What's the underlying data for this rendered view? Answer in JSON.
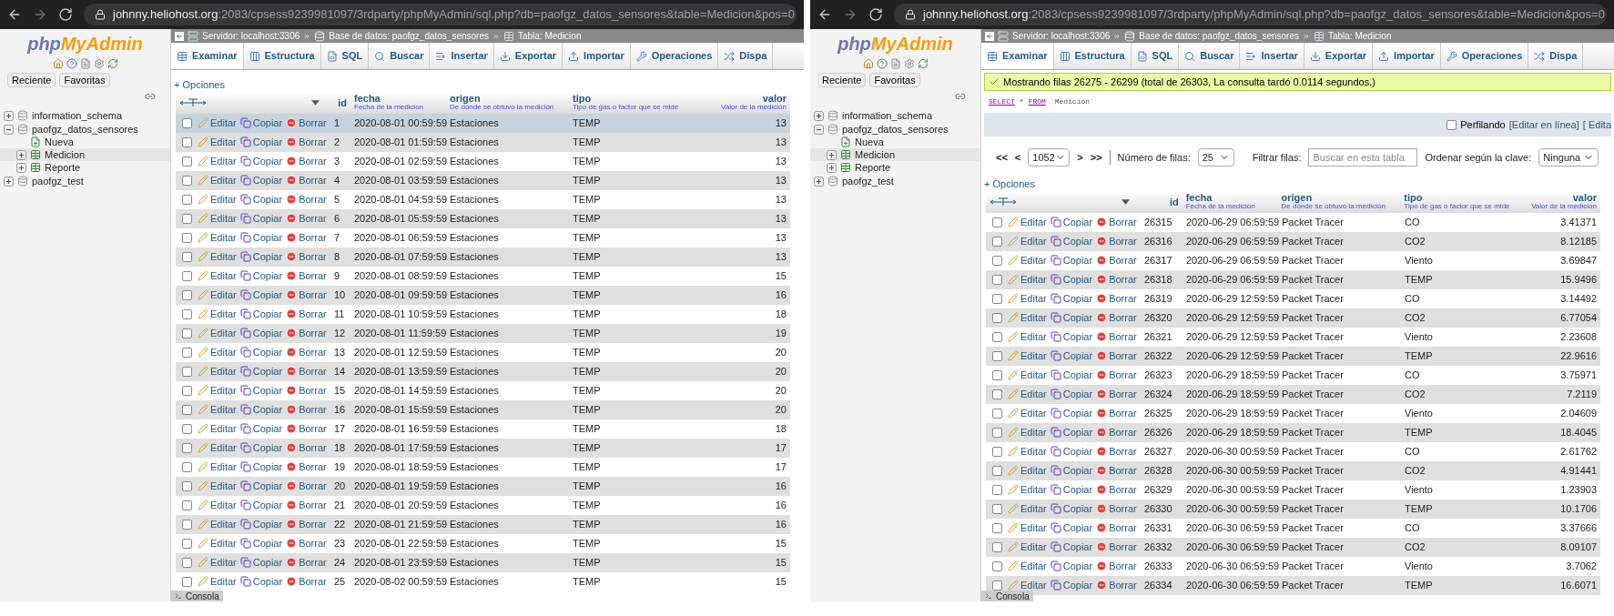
{
  "windows": [
    {
      "url": {
        "host": "johnny.heliohost.org",
        "path": ":2083/cpsess9239981097/3rdparty/phpMyAdmin/sql.php?db=paofgz_datos_sensores&table=Medicion&pos=0"
      },
      "sidebar": {
        "logo": {
          "part_1": "php",
          "part_2": "MyAdmin"
        },
        "buttons": [
          "Reciente",
          "Favoritas"
        ],
        "tree": [
          {
            "label": "information_schema",
            "kind": "database",
            "expanded": false,
            "selected": false
          },
          {
            "label": "paofgz_datos_sensores",
            "kind": "database",
            "expanded": true,
            "selected": false,
            "children": [
              {
                "label": "Nueva",
                "kind": "new",
                "selected": false
              },
              {
                "label": "Medicion",
                "kind": "table",
                "expanded": false,
                "selected": true
              },
              {
                "label": "Reporte",
                "kind": "table",
                "expanded": false,
                "selected": false
              }
            ]
          },
          {
            "label": "paofgz_test",
            "kind": "database",
            "expanded": false,
            "selected": false
          }
        ]
      },
      "breadcrumb": [
        "Servidor: localhost:3306",
        "Base de datos: paofgz_datos_sensores",
        "Tabla: Medicion"
      ],
      "tabs": [
        {
          "label": "Examinar",
          "selected": true
        },
        {
          "label": "Estructura",
          "selected": false
        },
        {
          "label": "SQL",
          "selected": false
        },
        {
          "label": "Buscar",
          "selected": false
        },
        {
          "label": "Insertar",
          "selected": false
        },
        {
          "label": "Exportar",
          "selected": false
        },
        {
          "label": "Importar",
          "selected": false
        },
        {
          "label": "Operaciones",
          "selected": false
        },
        {
          "label": "Dispa",
          "selected": false
        }
      ],
      "options_link": "+ Opciones",
      "columns": [
        {
          "name": "id"
        },
        {
          "name": "fecha",
          "comment": "Fecha de la medicion"
        },
        {
          "name": "origen",
          "comment": "De dónde se obtuvo la medición"
        },
        {
          "name": "tipo",
          "comment": "Tipo de gas o factor que se mide"
        },
        {
          "name": "valor",
          "comment": "Valor de la medición"
        }
      ],
      "rows": [
        {
          "actions": [
            "Editar",
            "Copiar",
            "Borrar"
          ],
          "id": "1",
          "fecha": "2020-08-01 00:59:59",
          "origen": "Estaciones",
          "tipo": "TEMP",
          "valor": "13",
          "checked": false,
          "highlighted": true
        },
        {
          "actions": [
            "Editar",
            "Copiar",
            "Borrar"
          ],
          "id": "2",
          "fecha": "2020-08-01 01:59:59",
          "origen": "Estaciones",
          "tipo": "TEMP",
          "valor": "13",
          "checked": false,
          "highlighted": false
        },
        {
          "actions": [
            "Editar",
            "Copiar",
            "Borrar"
          ],
          "id": "3",
          "fecha": "2020-08-01 02:59:59",
          "origen": "Estaciones",
          "tipo": "TEMP",
          "valor": "13",
          "checked": false,
          "highlighted": false
        },
        {
          "actions": [
            "Editar",
            "Copiar",
            "Borrar"
          ],
          "id": "4",
          "fecha": "2020-08-01 03:59:59",
          "origen": "Estaciones",
          "tipo": "TEMP",
          "valor": "13",
          "checked": false,
          "highlighted": false
        },
        {
          "actions": [
            "Editar",
            "Copiar",
            "Borrar"
          ],
          "id": "5",
          "fecha": "2020-08-01 04:59:59",
          "origen": "Estaciones",
          "tipo": "TEMP",
          "valor": "13",
          "checked": false,
          "highlighted": false
        },
        {
          "actions": [
            "Editar",
            "Copiar",
            "Borrar"
          ],
          "id": "6",
          "fecha": "2020-08-01 05:59:59",
          "origen": "Estaciones",
          "tipo": "TEMP",
          "valor": "13",
          "checked": false,
          "highlighted": false
        },
        {
          "actions": [
            "Editar",
            "Copiar",
            "Borrar"
          ],
          "id": "7",
          "fecha": "2020-08-01 06:59:59",
          "origen": "Estaciones",
          "tipo": "TEMP",
          "valor": "13",
          "checked": false,
          "highlighted": false
        },
        {
          "actions": [
            "Editar",
            "Copiar",
            "Borrar"
          ],
          "id": "8",
          "fecha": "2020-08-01 07:59:59",
          "origen": "Estaciones",
          "tipo": "TEMP",
          "valor": "13",
          "checked": false,
          "highlighted": false
        },
        {
          "actions": [
            "Editar",
            "Copiar",
            "Borrar"
          ],
          "id": "9",
          "fecha": "2020-08-01 08:59:59",
          "origen": "Estaciones",
          "tipo": "TEMP",
          "valor": "15",
          "checked": false,
          "highlighted": false
        },
        {
          "actions": [
            "Editar",
            "Copiar",
            "Borrar"
          ],
          "id": "10",
          "fecha": "2020-08-01 09:59:59",
          "origen": "Estaciones",
          "tipo": "TEMP",
          "valor": "16",
          "checked": false,
          "highlighted": false
        },
        {
          "actions": [
            "Editar",
            "Copiar",
            "Borrar"
          ],
          "id": "11",
          "fecha": "2020-08-01 10:59:59",
          "origen": "Estaciones",
          "tipo": "TEMP",
          "valor": "18",
          "checked": false,
          "highlighted": false
        },
        {
          "actions": [
            "Editar",
            "Copiar",
            "Borrar"
          ],
          "id": "12",
          "fecha": "2020-08-01 11:59:59",
          "origen": "Estaciones",
          "tipo": "TEMP",
          "valor": "19",
          "checked": false,
          "highlighted": false
        },
        {
          "actions": [
            "Editar",
            "Copiar",
            "Borrar"
          ],
          "id": "13",
          "fecha": "2020-08-01 12:59:59",
          "origen": "Estaciones",
          "tipo": "TEMP",
          "valor": "20",
          "checked": false,
          "highlighted": false
        },
        {
          "actions": [
            "Editar",
            "Copiar",
            "Borrar"
          ],
          "id": "14",
          "fecha": "2020-08-01 13:59:59",
          "origen": "Estaciones",
          "tipo": "TEMP",
          "valor": "20",
          "checked": false,
          "highlighted": false
        },
        {
          "actions": [
            "Editar",
            "Copiar",
            "Borrar"
          ],
          "id": "15",
          "fecha": "2020-08-01 14:59:59",
          "origen": "Estaciones",
          "tipo": "TEMP",
          "valor": "20",
          "checked": false,
          "highlighted": false
        },
        {
          "actions": [
            "Editar",
            "Copiar",
            "Borrar"
          ],
          "id": "16",
          "fecha": "2020-08-01 15:59:59",
          "origen": "Estaciones",
          "tipo": "TEMP",
          "valor": "20",
          "checked": false,
          "highlighted": false
        },
        {
          "actions": [
            "Editar",
            "Copiar",
            "Borrar"
          ],
          "id": "17",
          "fecha": "2020-08-01 16:59:59",
          "origen": "Estaciones",
          "tipo": "TEMP",
          "valor": "18",
          "checked": false,
          "highlighted": false
        },
        {
          "actions": [
            "Editar",
            "Copiar",
            "Borrar"
          ],
          "id": "18",
          "fecha": "2020-08-01 17:59:59",
          "origen": "Estaciones",
          "tipo": "TEMP",
          "valor": "17",
          "checked": false,
          "highlighted": false
        },
        {
          "actions": [
            "Editar",
            "Copiar",
            "Borrar"
          ],
          "id": "19",
          "fecha": "2020-08-01 18:59:59",
          "origen": "Estaciones",
          "tipo": "TEMP",
          "valor": "17",
          "checked": false,
          "highlighted": false
        },
        {
          "actions": [
            "Editar",
            "Copiar",
            "Borrar"
          ],
          "id": "20",
          "fecha": "2020-08-01 19:59:59",
          "origen": "Estaciones",
          "tipo": "TEMP",
          "valor": "16",
          "checked": false,
          "highlighted": false
        },
        {
          "actions": [
            "Editar",
            "Copiar",
            "Borrar"
          ],
          "id": "21",
          "fecha": "2020-08-01 20:59:59",
          "origen": "Estaciones",
          "tipo": "TEMP",
          "valor": "16",
          "checked": false,
          "highlighted": false
        },
        {
          "actions": [
            "Editar",
            "Copiar",
            "Borrar"
          ],
          "id": "22",
          "fecha": "2020-08-01 21:59:59",
          "origen": "Estaciones",
          "tipo": "TEMP",
          "valor": "16",
          "checked": false,
          "highlighted": false
        },
        {
          "actions": [
            "Editar",
            "Copiar",
            "Borrar"
          ],
          "id": "23",
          "fecha": "2020-08-01 22:59:59",
          "origen": "Estaciones",
          "tipo": "TEMP",
          "valor": "15",
          "checked": false,
          "highlighted": false
        },
        {
          "actions": [
            "Editar",
            "Copiar",
            "Borrar"
          ],
          "id": "24",
          "fecha": "2020-08-01 23:59:59",
          "origen": "Estaciones",
          "tipo": "TEMP",
          "valor": "15",
          "checked": false,
          "highlighted": false
        },
        {
          "actions": [
            "Editar",
            "Copiar",
            "Borrar"
          ],
          "id": "25",
          "fecha": "2020-08-02 00:59:59",
          "origen": "Estaciones",
          "tipo": "TEMP",
          "valor": "15",
          "checked": false,
          "highlighted": false
        }
      ],
      "console": "Consola"
    },
    {
      "url": {
        "host": "johnny.heliohost.org",
        "path": ":2083/cpsess9239981097/3rdparty/phpMyAdmin/sql.php?db=paofgz_datos_sensores&table=Medicion&pos=0"
      },
      "sidebar": {
        "logo": {
          "part_1": "php",
          "part_2": "MyAdmin"
        },
        "buttons": [
          "Reciente",
          "Favoritas"
        ],
        "tree": [
          {
            "label": "information_schema",
            "kind": "database",
            "expanded": false,
            "selected": false
          },
          {
            "label": "paofgz_datos_sensores",
            "kind": "database",
            "expanded": true,
            "selected": false,
            "children": [
              {
                "label": "Nueva",
                "kind": "new",
                "selected": false
              },
              {
                "label": "Medicion",
                "kind": "table",
                "expanded": false,
                "selected": true
              },
              {
                "label": "Reporte",
                "kind": "table",
                "expanded": false,
                "selected": false
              }
            ]
          },
          {
            "label": "paofgz_test",
            "kind": "database",
            "expanded": false,
            "selected": false
          }
        ]
      },
      "breadcrumb": [
        "Servidor: localhost:3306",
        "Base de datos: paofgz_datos_sensores",
        "Tabla: Medicion"
      ],
      "tabs": [
        {
          "label": "Examinar",
          "selected": true
        },
        {
          "label": "Estructura",
          "selected": false
        },
        {
          "label": "SQL",
          "selected": false
        },
        {
          "label": "Buscar",
          "selected": false
        },
        {
          "label": "Insertar",
          "selected": false
        },
        {
          "label": "Exportar",
          "selected": false
        },
        {
          "label": "Importar",
          "selected": false
        },
        {
          "label": "Operaciones",
          "selected": false
        },
        {
          "label": "Dispa",
          "selected": false
        }
      ],
      "message": "Mostrando filas 26275 - 26299 (total de 26303, La consulta tardó 0.0114 segundos.)",
      "sql": [
        {
          "kind": "keyword",
          "text": "SELECT"
        },
        {
          "kind": "operator",
          "text": "*"
        },
        {
          "kind": "keyword",
          "text": "FROM"
        },
        {
          "kind": "identifier",
          "text": "`Medicion`"
        }
      ],
      "profiling": {
        "label": "Perfilando",
        "checked": false,
        "links": [
          "[Editar en línea]",
          "[ Edita"
        ]
      },
      "pagination": {
        "first": "<<",
        "prev": "<",
        "page": "1052",
        "next": ">",
        "last": ">>",
        "rows_label": "Número de filas:",
        "rows_value": "25",
        "filter_label": "Filtrar filas:",
        "filter_placeholder": "Buscar en esta tabla",
        "sort_label": "Ordenar según la clave:",
        "sort_value": "Ninguna"
      },
      "options_link": "+ Opciones",
      "columns": [
        {
          "name": "id"
        },
        {
          "name": "fecha",
          "comment": "Fecha de la medicion"
        },
        {
          "name": "origen",
          "comment": "De dónde se obtuvo la medición"
        },
        {
          "name": "tipo",
          "comment": "Tipo de gas o factor que se mide"
        },
        {
          "name": "valor",
          "comment": "Valor de la medición"
        }
      ],
      "rows": [
        {
          "actions": [
            "Editar",
            "Copiar",
            "Borrar"
          ],
          "id": "26315",
          "fecha": "2020-06-29 06:59:59",
          "origen": "Packet Tracer",
          "tipo": "CO",
          "valor": "3.41371",
          "checked": false,
          "highlighted": false
        },
        {
          "actions": [
            "Editar",
            "Copiar",
            "Borrar"
          ],
          "id": "26316",
          "fecha": "2020-06-29 06:59:59",
          "origen": "Packet Tracer",
          "tipo": "CO2",
          "valor": "8.12185",
          "checked": false,
          "highlighted": false
        },
        {
          "actions": [
            "Editar",
            "Copiar",
            "Borrar"
          ],
          "id": "26317",
          "fecha": "2020-06-29 06:59:59",
          "origen": "Packet Tracer",
          "tipo": "Viento",
          "valor": "3.69847",
          "checked": false,
          "highlighted": false
        },
        {
          "actions": [
            "Editar",
            "Copiar",
            "Borrar"
          ],
          "id": "26318",
          "fecha": "2020-06-29 06:59:59",
          "origen": "Packet Tracer",
          "tipo": "TEMP",
          "valor": "15.9496",
          "checked": false,
          "highlighted": false
        },
        {
          "actions": [
            "Editar",
            "Copiar",
            "Borrar"
          ],
          "id": "26319",
          "fecha": "2020-06-29 12:59:59",
          "origen": "Packet Tracer",
          "tipo": "CO",
          "valor": "3.14492",
          "checked": false,
          "highlighted": false
        },
        {
          "actions": [
            "Editar",
            "Copiar",
            "Borrar"
          ],
          "id": "26320",
          "fecha": "2020-06-29 12:59:59",
          "origen": "Packet Tracer",
          "tipo": "CO2",
          "valor": "6.77054",
          "checked": false,
          "highlighted": false
        },
        {
          "actions": [
            "Editar",
            "Copiar",
            "Borrar"
          ],
          "id": "26321",
          "fecha": "2020-06-29 12:59:59",
          "origen": "Packet Tracer",
          "tipo": "Viento",
          "valor": "2.23608",
          "checked": false,
          "highlighted": false
        },
        {
          "actions": [
            "Editar",
            "Copiar",
            "Borrar"
          ],
          "id": "26322",
          "fecha": "2020-06-29 12:59:59",
          "origen": "Packet Tracer",
          "tipo": "TEMP",
          "valor": "22.9616",
          "checked": false,
          "highlighted": false
        },
        {
          "actions": [
            "Editar",
            "Copiar",
            "Borrar"
          ],
          "id": "26323",
          "fecha": "2020-06-29 18:59:59",
          "origen": "Packet Tracer",
          "tipo": "CO",
          "valor": "3.75971",
          "checked": false,
          "highlighted": false
        },
        {
          "actions": [
            "Editar",
            "Copiar",
            "Borrar"
          ],
          "id": "26324",
          "fecha": "2020-06-29 18:59:59",
          "origen": "Packet Tracer",
          "tipo": "CO2",
          "valor": "7.2119",
          "checked": false,
          "highlighted": false
        },
        {
          "actions": [
            "Editar",
            "Copiar",
            "Borrar"
          ],
          "id": "26325",
          "fecha": "2020-06-29 18:59:59",
          "origen": "Packet Tracer",
          "tipo": "Viento",
          "valor": "2.04609",
          "checked": false,
          "highlighted": false
        },
        {
          "actions": [
            "Editar",
            "Copiar",
            "Borrar"
          ],
          "id": "26326",
          "fecha": "2020-06-29 18:59:59",
          "origen": "Packet Tracer",
          "tipo": "TEMP",
          "valor": "18.4045",
          "checked": false,
          "highlighted": false
        },
        {
          "actions": [
            "Editar",
            "Copiar",
            "Borrar"
          ],
          "id": "26327",
          "fecha": "2020-06-30 00:59:59",
          "origen": "Packet Tracer",
          "tipo": "CO",
          "valor": "2.61762",
          "checked": false,
          "highlighted": false
        },
        {
          "actions": [
            "Editar",
            "Copiar",
            "Borrar"
          ],
          "id": "26328",
          "fecha": "2020-06-30 00:59:59",
          "origen": "Packet Tracer",
          "tipo": "CO2",
          "valor": "4.91441",
          "checked": false,
          "highlighted": false
        },
        {
          "actions": [
            "Editar",
            "Copiar",
            "Borrar"
          ],
          "id": "26329",
          "fecha": "2020-06-30 00:59:59",
          "origen": "Packet Tracer",
          "tipo": "Viento",
          "valor": "1.23903",
          "checked": false,
          "highlighted": false
        },
        {
          "actions": [
            "Editar",
            "Copiar",
            "Borrar"
          ],
          "id": "26330",
          "fecha": "2020-06-30 00:59:59",
          "origen": "Packet Tracer",
          "tipo": "TEMP",
          "valor": "10.1706",
          "checked": false,
          "highlighted": false
        },
        {
          "actions": [
            "Editar",
            "Copiar",
            "Borrar"
          ],
          "id": "26331",
          "fecha": "2020-06-30 06:59:59",
          "origen": "Packet Tracer",
          "tipo": "CO",
          "valor": "3.37666",
          "checked": false,
          "highlighted": false
        },
        {
          "actions": [
            "Editar",
            "Copiar",
            "Borrar"
          ],
          "id": "26332",
          "fecha": "2020-06-30 06:59:59",
          "origen": "Packet Tracer",
          "tipo": "CO2",
          "valor": "8.09107",
          "checked": false,
          "highlighted": false
        },
        {
          "actions": [
            "Editar",
            "Copiar",
            "Borrar"
          ],
          "id": "26333",
          "fecha": "2020-06-30 06:59:59",
          "origen": "Packet Tracer",
          "tipo": "Viento",
          "valor": "3.7062",
          "checked": false,
          "highlighted": false
        },
        {
          "actions": [
            "Editar",
            "Copiar",
            "Borrar"
          ],
          "id": "26334",
          "fecha": "2020-06-30 06:59:59",
          "origen": "Packet Tracer",
          "tipo": "TEMP",
          "valor": "16.6071",
          "checked": false,
          "highlighted": false
        }
      ],
      "console": "Consola"
    }
  ]
}
